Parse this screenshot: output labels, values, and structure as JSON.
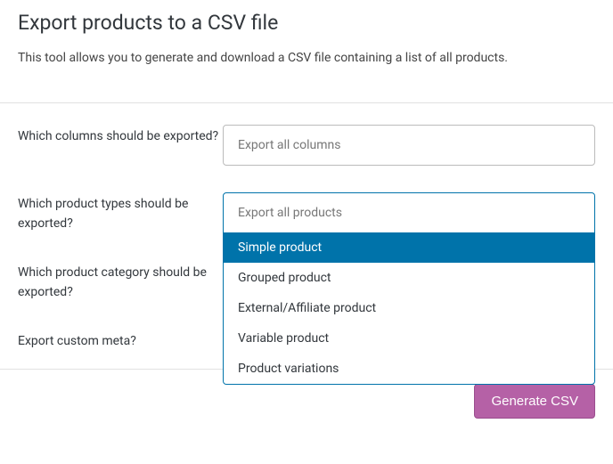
{
  "title": "Export products to a CSV file",
  "description": "This tool allows you to generate and download a CSV file containing a list of all products.",
  "fields": {
    "columns": {
      "label": "Which columns should be exported?",
      "placeholder": "Export all columns"
    },
    "types": {
      "label": "Which product types should be exported?",
      "placeholder": "Export all products",
      "options": [
        "Simple product",
        "Grouped product",
        "External/Affiliate product",
        "Variable product",
        "Product variations"
      ]
    },
    "category": {
      "label": "Which product category should be exported?"
    },
    "meta": {
      "label": "Export custom meta?"
    }
  },
  "button_generate": "Generate CSV"
}
